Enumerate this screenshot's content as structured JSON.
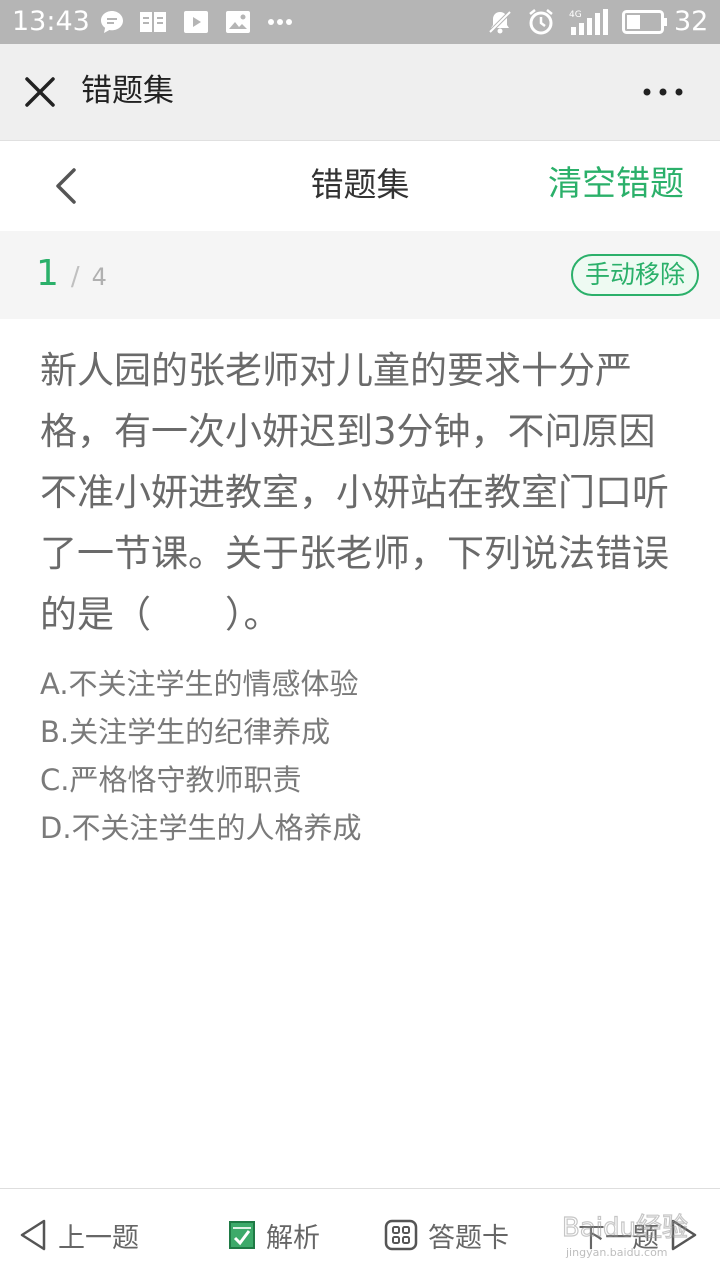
{
  "status_bar": {
    "time": "13:43",
    "battery_level": "32",
    "network": "4G",
    "icons": [
      "chat-bubble-icon",
      "book-icon",
      "play-icon",
      "image-icon",
      "more-dots-icon",
      "mute-bell-icon",
      "alarm-icon",
      "signal-icon",
      "battery-icon"
    ]
  },
  "title_bar": {
    "title": "错题集",
    "icons": [
      "close-icon",
      "more-icon"
    ]
  },
  "page_header": {
    "title": "错题集",
    "clear_label": "清空错题"
  },
  "progress": {
    "current": "1",
    "separator": "/",
    "total": "4",
    "remove_label": "手动移除"
  },
  "question": {
    "text": "新人园的张老师对儿童的要求十分严格，有一次小妍迟到3分钟，不问原因不准小妍进教室，小妍站在教室门口听了一节课。关于张老师，下列说法错误的是（　　）。",
    "options": [
      "A.不关注学生的情感体验",
      "B.关注学生的纪律养成",
      "C.严格恪守教师职责",
      "D.不关注学生的人格养成"
    ]
  },
  "bottom_bar": {
    "prev_label": "上一题",
    "analysis_label": "解析",
    "answer_card_label": "答题卡",
    "next_label": "下一题"
  },
  "colors": {
    "accent": "#2bb06a",
    "status_bar_bg": "#b5b5b5",
    "title_bar_bg": "#efefef",
    "progress_bg": "#f5f5f5",
    "question_text": "#6a6a6a",
    "option_text": "#7a7a7a"
  },
  "watermark": {
    "text": "Baidu经验",
    "url_text": "jingyan.baidu.com"
  }
}
